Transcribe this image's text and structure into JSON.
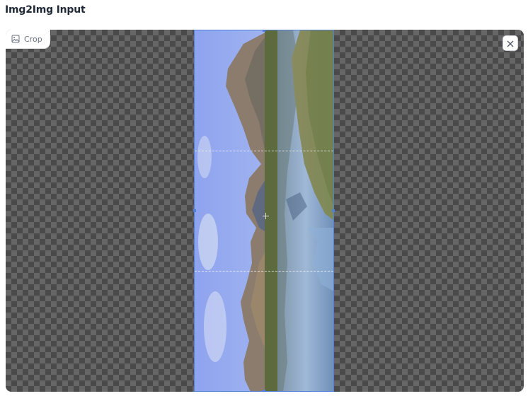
{
  "panel": {
    "title": "Img2Img Input"
  },
  "toolbar": {
    "crop_label": "Crop",
    "crop_icon": "image-icon",
    "close_icon": "close-icon"
  },
  "editor": {
    "mode": "crop",
    "background": "transparent-checkerboard",
    "image": "landscape photo of mountains and lake, rotated 90 degrees",
    "crop_accent": "#4f7fd8"
  }
}
